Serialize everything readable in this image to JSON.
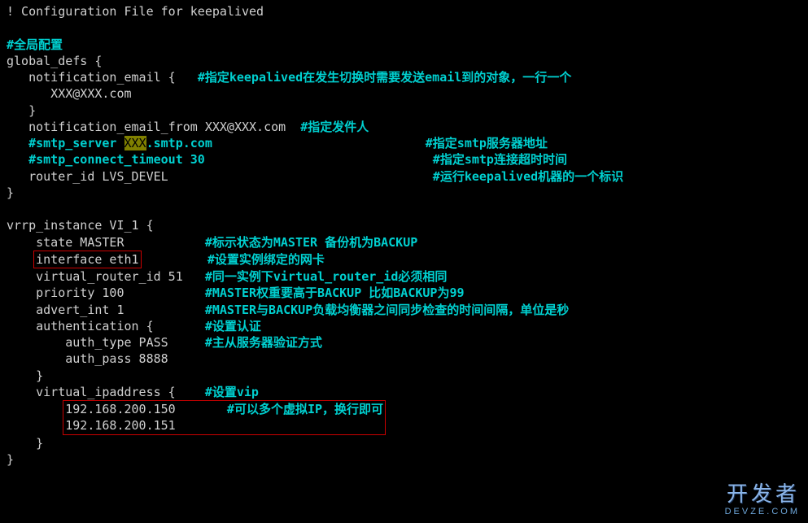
{
  "header": "! Configuration File for keepalived",
  "section1_comment": "#全局配置",
  "global_defs_open": "global_defs {",
  "notif_email_open": "   notification_email {   ",
  "notif_email_comment": "#指定keepalived在发生切换时需要发送email到的对象，一行一个",
  "notif_email_addr": "      XXX@XXX.com",
  "notif_email_close": "   }",
  "notif_from": "   notification_email_from XXX@XXX.com  ",
  "notif_from_comment": "#指定发件人",
  "smtp_server_pre": "   #smtp_server ",
  "smtp_server_hl": "XXX",
  "smtp_server_post": ".smtp.com                             ",
  "smtp_server_comment": "#指定smtp服务器地址",
  "smtp_timeout": "   #smtp_connect_timeout 30                               ",
  "smtp_timeout_comment": "#指定smtp连接超时时间",
  "router_id": "   router_id LVS_DEVEL                                    ",
  "router_id_comment": "#运行keepalived机器的一个标识",
  "global_close": "}",
  "vrrp_open": "vrrp_instance VI_1 {",
  "state": "    state MASTER           ",
  "state_comment": "#标示状态为MASTER 备份机为BACKUP",
  "interface": "interface eth1",
  "interface_pad": "         ",
  "interface_comment": "#设置实例绑定的网卡",
  "vrouter": "    virtual_router_id 51   ",
  "vrouter_comment": "#同一实例下virtual_router_id必须相同",
  "priority": "    priority 100           ",
  "priority_comment": "#MASTER权重要高于BACKUP 比如BACKUP为99",
  "advert": "    advert_int 1           ",
  "advert_comment": "#MASTER与BACKUP负载均衡器之间同步检查的时间间隔，单位是秒",
  "auth_open": "    authentication {       ",
  "auth_comment": "#设置认证",
  "auth_type": "        auth_type PASS     ",
  "auth_type_comment": "#主从服务器验证方式",
  "auth_pass": "        auth_pass 8888",
  "auth_close": "    }",
  "vip_open": "    virtual_ipaddress {    ",
  "vip_comment": "#设置vip",
  "vip1": "192.168.200.150",
  "vip2": "192.168.200.151",
  "vip_inner_comment": "       #可以多个虚拟IP，换行即可",
  "vip_close": "    }",
  "vrrp_close": "}",
  "watermark_main": "开发者",
  "watermark_sub": "DEVZE.COM"
}
